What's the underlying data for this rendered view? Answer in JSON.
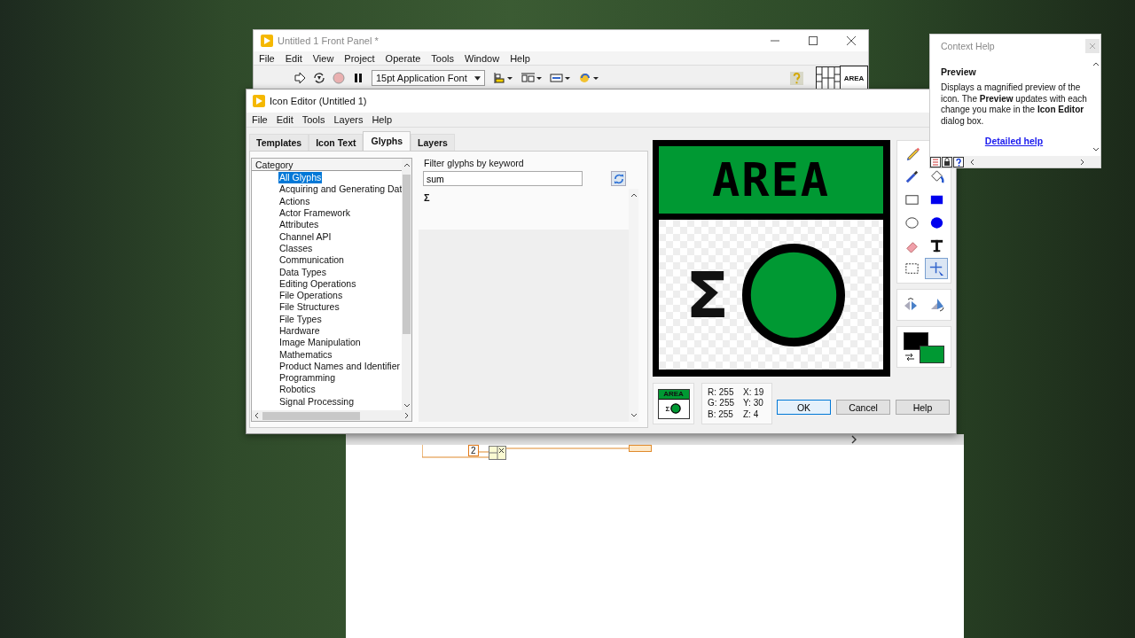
{
  "front_panel": {
    "title": "Untitled 1 Front Panel *",
    "menu": [
      "File",
      "Edit",
      "View",
      "Project",
      "Operate",
      "Tools",
      "Window",
      "Help"
    ],
    "font_selector": "15pt Application Font",
    "icon_text": "AREA"
  },
  "icon_editor": {
    "title": "Icon Editor (Untitled 1)",
    "menu": [
      "File",
      "Edit",
      "Tools",
      "Layers",
      "Help"
    ],
    "tabs": [
      {
        "label": "Templates",
        "selected": false
      },
      {
        "label": "Icon Text",
        "selected": false
      },
      {
        "label": "Glyphs",
        "selected": true
      },
      {
        "label": "Layers",
        "selected": false
      }
    ],
    "category_header": "Category",
    "categories": [
      {
        "label": "All Glyphs",
        "selected": true
      },
      {
        "label": "Acquiring and Generating Dat",
        "selected": false
      },
      {
        "label": "Actions",
        "selected": false
      },
      {
        "label": "Actor Framework",
        "selected": false
      },
      {
        "label": "Attributes",
        "selected": false
      },
      {
        "label": "Channel API",
        "selected": false
      },
      {
        "label": "Classes",
        "selected": false
      },
      {
        "label": "Communication",
        "selected": false
      },
      {
        "label": "Data Types",
        "selected": false
      },
      {
        "label": "Editing Operations",
        "selected": false
      },
      {
        "label": "File Operations",
        "selected": false
      },
      {
        "label": "File Structures",
        "selected": false
      },
      {
        "label": "File Types",
        "selected": false
      },
      {
        "label": "Hardware",
        "selected": false
      },
      {
        "label": "Image Manipulation",
        "selected": false
      },
      {
        "label": "Mathematics",
        "selected": false
      },
      {
        "label": "Product Names and Identifier",
        "selected": false
      },
      {
        "label": "Programming",
        "selected": false
      },
      {
        "label": "Robotics",
        "selected": false
      },
      {
        "label": "Signal Processing",
        "selected": false
      }
    ],
    "filter_label": "Filter glyphs by keyword",
    "filter_value": "sum",
    "glyph_results": [
      "Σ"
    ],
    "preview": {
      "banner_text": "AREA",
      "glyph": "Σ"
    },
    "tools": [
      {
        "kind": "pencil",
        "selected": false
      },
      {
        "kind": "dropper",
        "selected": false
      },
      {
        "kind": "fill",
        "selected": false
      },
      {
        "kind": "rect",
        "selected": false
      },
      {
        "kind": "filled-rect",
        "selected": false
      },
      {
        "kind": "ellipse",
        "selected": false
      },
      {
        "kind": "filled-ellipse",
        "selected": false
      },
      {
        "kind": "eraser",
        "selected": false
      },
      {
        "kind": "text",
        "selected": false
      },
      {
        "kind": "select",
        "selected": false
      },
      {
        "kind": "move",
        "selected": true
      }
    ],
    "colors": [
      {
        "kind": "foreground",
        "color": "#000000"
      },
      {
        "kind": "background",
        "color": "#009933"
      }
    ],
    "thumbnail": {
      "banner_text": "AREA",
      "glyph": "Σ"
    },
    "readout": [
      "R: 255",
      "X: 19",
      "G: 255",
      "Y: 30",
      "B: 255",
      "Z: 4"
    ],
    "buttons": [
      {
        "label": "OK",
        "focused": true
      },
      {
        "label": "Cancel",
        "focused": false
      },
      {
        "label": "Help",
        "focused": false
      }
    ]
  },
  "context_help": {
    "title": "Context Help",
    "heading": "Preview",
    "body": "Displays a magnified preview of the icon. The **Preview** updates with each change you make in the **Icon Editor** dialog box.",
    "link": "Detailed help"
  },
  "block_diagram": {
    "constant": "2"
  }
}
